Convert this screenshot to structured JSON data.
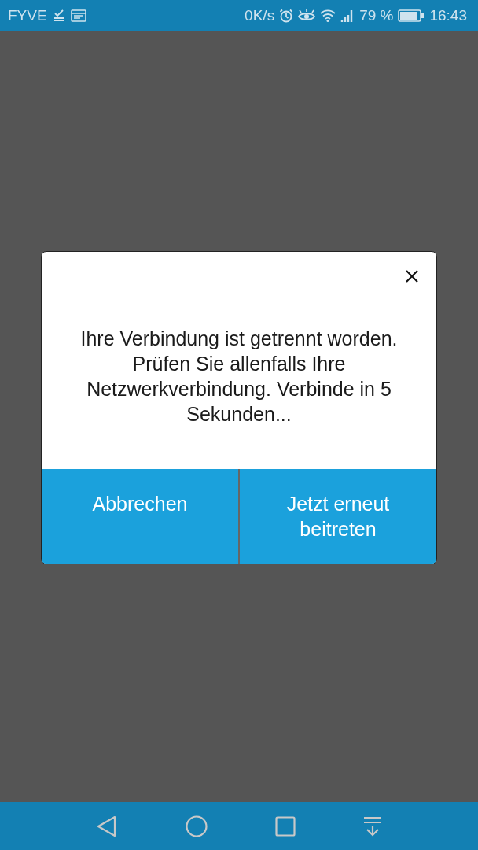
{
  "status_bar": {
    "carrier": "FYVE",
    "speed": "0K/s",
    "battery": "79 %",
    "time": "16:43"
  },
  "dialog": {
    "message": "Ihre Verbindung ist getrennt worden. Prüfen Sie allenfalls Ihre Netzwerkverbindung. Verbinde in 5 Sekunden...",
    "buttons": [
      "Abbrechen",
      "Jetzt erneut beitreten"
    ]
  }
}
